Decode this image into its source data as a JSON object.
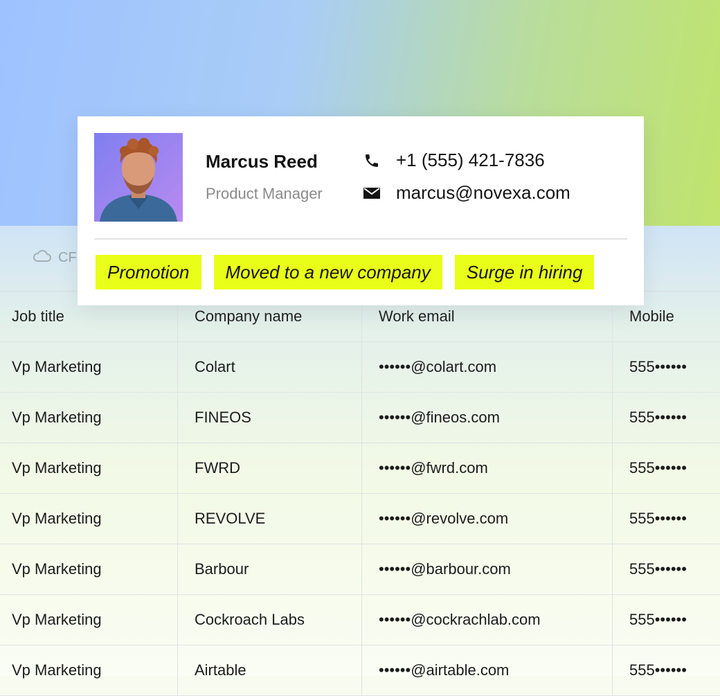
{
  "profile": {
    "name": "Marcus Reed",
    "role": "Product Manager",
    "phone": "+1 (555) 421-7836",
    "email": "marcus@novexa.com",
    "tags": [
      "Promotion",
      "Moved to a new company",
      "Surge in hiring"
    ]
  },
  "toolbar": {
    "label": "CF"
  },
  "table": {
    "headers": [
      "Job title",
      "Company name",
      "Work email",
      "Mobile"
    ],
    "rows": [
      [
        "Vp Marketing",
        "Colart",
        "••••••@colart.com",
        "555••••••"
      ],
      [
        "Vp Marketing",
        "FINEOS",
        "••••••@fineos.com",
        "555••••••"
      ],
      [
        "Vp Marketing",
        "FWRD",
        "••••••@fwrd.com",
        "555••••••"
      ],
      [
        "Vp Marketing",
        "REVOLVE",
        "••••••@revolve.com",
        "555••••••"
      ],
      [
        "Vp Marketing",
        "Barbour",
        "••••••@barbour.com",
        "555••••••"
      ],
      [
        "Vp Marketing",
        "Cockroach Labs",
        "••••••@cockrachlab.com",
        "555••••••"
      ],
      [
        "Vp Marketing",
        "Airtable",
        "••••••@airtable.com",
        "555••••••"
      ]
    ]
  },
  "colors": {
    "tag": "#e9ff19",
    "accent_blue": "#9ec2ff",
    "accent_green": "#c0e46c"
  },
  "icons": {
    "phone": "phone-icon",
    "email": "mail-icon",
    "cloud": "cloud-icon"
  }
}
